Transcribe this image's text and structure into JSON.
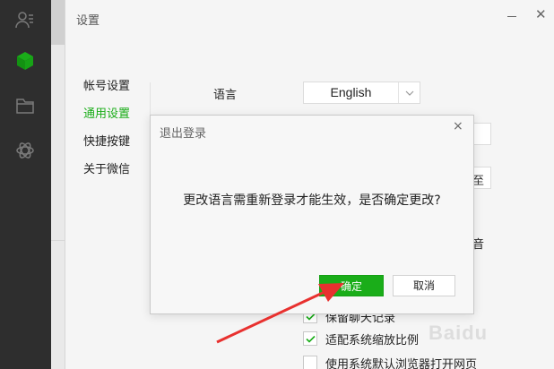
{
  "nav": {
    "icons": [
      "contacts-icon",
      "cube-icon",
      "folder-icon",
      "network-icon"
    ],
    "colors": {
      "active": "#1aad19",
      "inactive": "#7a7a7a",
      "background": "#2e2e2e"
    }
  },
  "window": {
    "title": "设置",
    "close_glyph": "✕"
  },
  "menu": {
    "items": [
      {
        "label": "帐号设置"
      },
      {
        "label": "通用设置"
      },
      {
        "label": "快捷按键"
      },
      {
        "label": "关于微信"
      }
    ],
    "active_index": 1
  },
  "general": {
    "language_label": "语言",
    "language_value": "English",
    "peek_button_fragment": "至",
    "peek_option_fragment": "音",
    "options": [
      {
        "label": "保留聊天记录",
        "checked": true
      },
      {
        "label": "适配系统缩放比例",
        "checked": true
      },
      {
        "label": "使用系统默认浏览器打开网页",
        "checked": false
      }
    ]
  },
  "dialog": {
    "title": "退出登录",
    "close_glyph": "×",
    "message": "更改语言需重新登录才能生效，是否确定更改?",
    "confirm_label": "确定",
    "cancel_label": "取消",
    "confirm_color": "#1aad19"
  },
  "annotation": {
    "arrow_color": "#e8312f"
  },
  "watermark": {
    "text": "Baidu"
  }
}
